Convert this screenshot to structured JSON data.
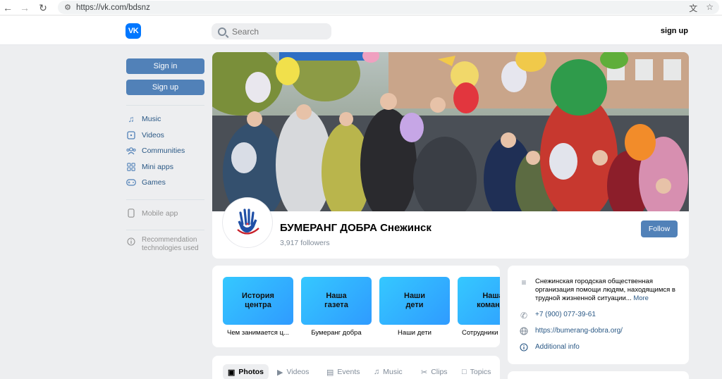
{
  "browser": {
    "url": "https://vk.com/bdsnz"
  },
  "header": {
    "logo_text": "VK",
    "search_placeholder": "Search",
    "signup_label": "sign up"
  },
  "sidebar": {
    "signin_label": "Sign in",
    "signup_label": "Sign up",
    "items": [
      {
        "label": "Music",
        "icon": "music-icon"
      },
      {
        "label": "Videos",
        "icon": "video-icon"
      },
      {
        "label": "Communities",
        "icon": "communities-icon"
      },
      {
        "label": "Mini apps",
        "icon": "mini-apps-icon"
      },
      {
        "label": "Games",
        "icon": "gamepad-icon"
      }
    ],
    "mobile_app_label": "Mobile app",
    "recommendation_label": "Recommendation technologies used"
  },
  "profile": {
    "name": "БУМЕРАНГ ДОБРА Снежинск",
    "followers": "3,917 followers",
    "follow_label": "Follow"
  },
  "tiles": [
    {
      "title": "История центра",
      "caption": "Чем занимается ц..."
    },
    {
      "title": "Наша газета",
      "caption": "Бумеранг добра"
    },
    {
      "title": "Наши дети",
      "caption": "Наши дети"
    },
    {
      "title": "Наша команда",
      "caption": "Сотрудники"
    }
  ],
  "info": {
    "description": "Снежинская городская общественная организация помощи людям, находящимся в трудной жизненной ситуации...",
    "more_label": "More",
    "phone": "+7 (900) 077-39-61",
    "website": "https://bumerang-dobra.org/",
    "additional": "Additional info"
  },
  "tabs": [
    {
      "label": "Photos",
      "active": true
    },
    {
      "label": "Videos"
    },
    {
      "label": "Events"
    },
    {
      "label": "Music"
    },
    {
      "label": "Clips"
    },
    {
      "label": "Topics"
    }
  ],
  "colors": {
    "accent": "#5181b8",
    "vk_blue": "#0077ff",
    "link": "#2a5885",
    "background": "#edeef0"
  }
}
